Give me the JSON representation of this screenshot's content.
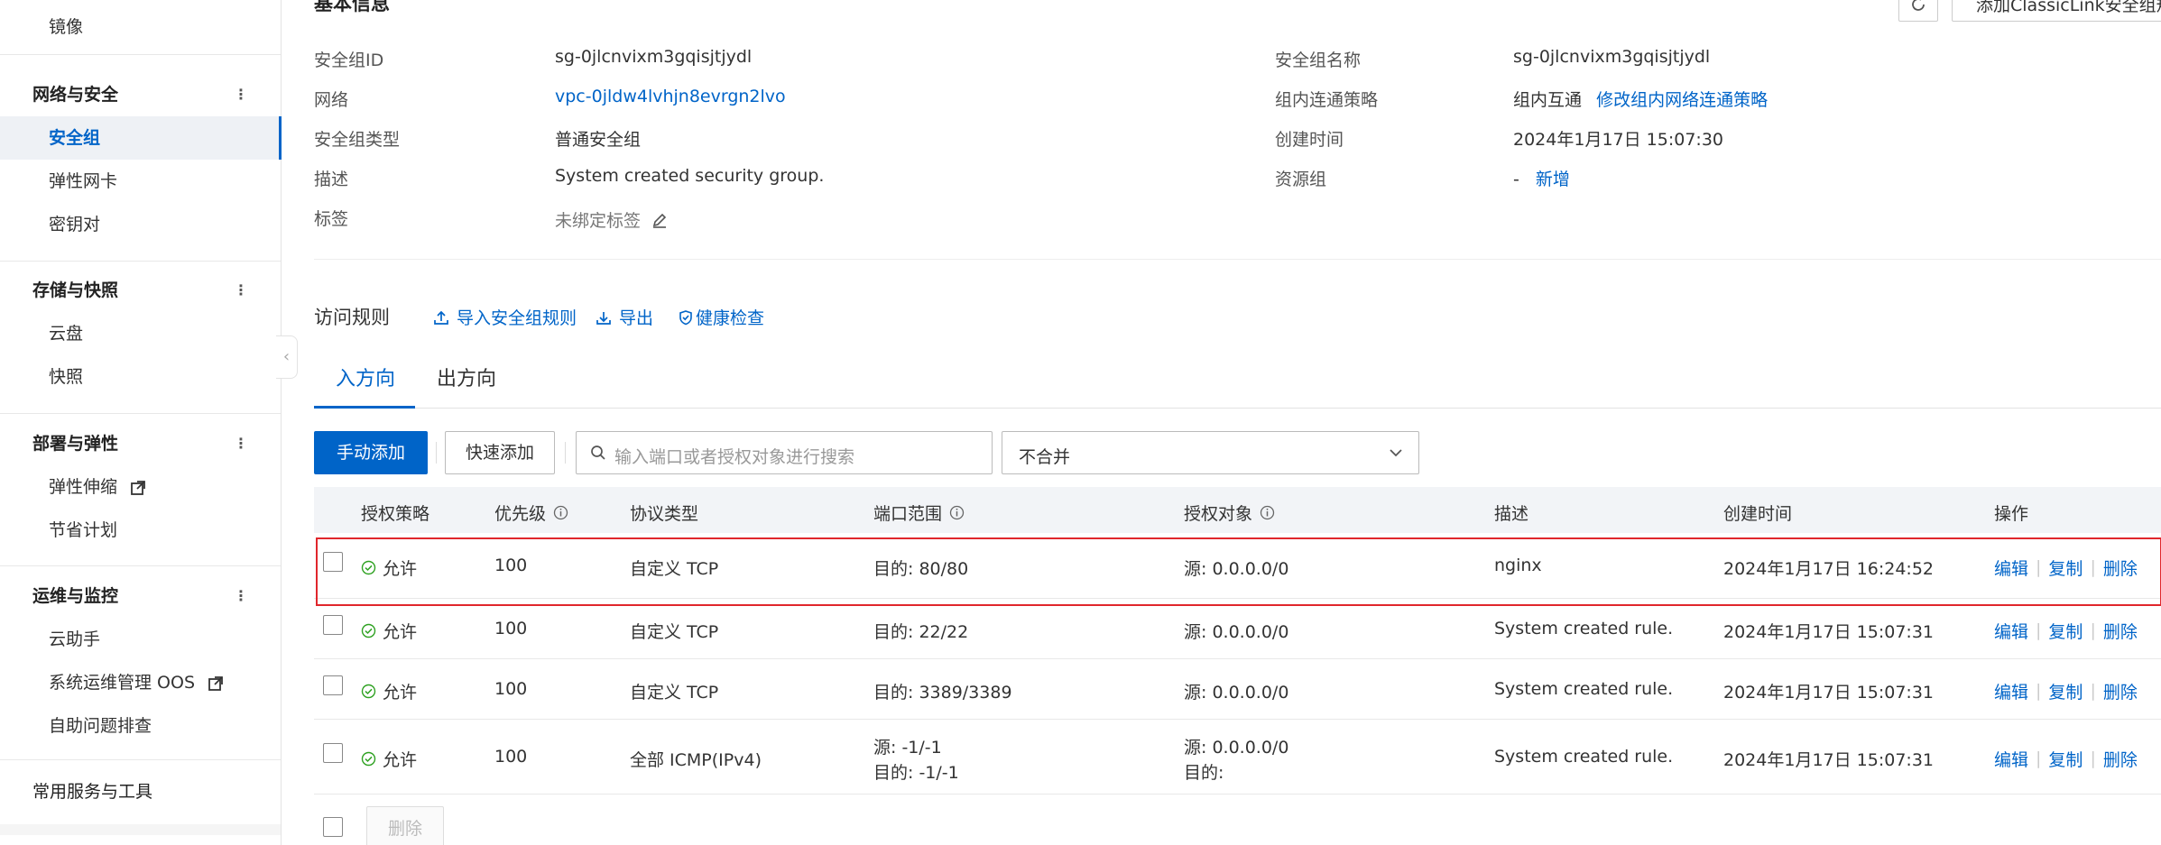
{
  "sidebar": {
    "top_item": "镜像",
    "groups": [
      {
        "label": "网络与安全",
        "items": [
          "安全组",
          "弹性网卡",
          "密钥对"
        ]
      },
      {
        "label": "存储与快照",
        "items": [
          "云盘",
          "快照"
        ]
      },
      {
        "label": "部署与弹性",
        "items": [
          "弹性伸缩",
          "节省计划"
        ]
      },
      {
        "label": "运维与监控",
        "items": [
          "云助手",
          "系统运维管理 OOS",
          "自助问题排查"
        ]
      }
    ],
    "bottom_item": "常用服务与工具",
    "active_item": "安全组"
  },
  "header": {
    "section_title": "基本信息",
    "top_right_button": "添加ClassicLink安全组规则"
  },
  "info": {
    "left": [
      {
        "label": "安全组ID",
        "value": "sg-0jlcnvixm3gqisjtjydl"
      },
      {
        "label": "网络",
        "value": "vpc-0jldw4lvhjn8evrgn2lvo"
      },
      {
        "label": "安全组类型",
        "value": "普通安全组"
      },
      {
        "label": "描述",
        "value": "System created security group."
      },
      {
        "label": "标签",
        "value": "未绑定标签"
      }
    ],
    "right": [
      {
        "label": "安全组名称",
        "value": "sg-0jlcnvixm3gqisjtjydl"
      },
      {
        "label": "组内连通策略",
        "value": "组内互通",
        "link": "修改组内网络连通策略"
      },
      {
        "label": "创建时间",
        "value": "2024年1月17日 15:07:30"
      },
      {
        "label": "资源组",
        "value": "-",
        "link": "新增"
      }
    ]
  },
  "rules": {
    "title": "访问规则",
    "actions": [
      "导入安全组规则",
      "导出",
      "健康检查"
    ],
    "tabs": [
      "入方向",
      "出方向"
    ],
    "active_tab": "入方向",
    "buttons": {
      "manual_add": "手动添加",
      "quick_add": "快速添加"
    },
    "search_placeholder": "输入端口或者授权对象进行搜索",
    "merge_select": "不合并",
    "columns": [
      "授权策略",
      "优先级",
      "协议类型",
      "端口范围",
      "授权对象",
      "描述",
      "创建时间",
      "操作"
    ],
    "rows": [
      {
        "policy": "允许",
        "priority": "100",
        "protocol": "自定义 TCP",
        "port": "目的: 80/80",
        "port2": "",
        "object": "源: 0.0.0.0/0",
        "object2": "",
        "desc": "nginx",
        "created": "2024年1月17日 16:24:52"
      },
      {
        "policy": "允许",
        "priority": "100",
        "protocol": "自定义 TCP",
        "port": "目的: 22/22",
        "port2": "",
        "object": "源: 0.0.0.0/0",
        "object2": "",
        "desc": "System created rule.",
        "created": "2024年1月17日 15:07:31"
      },
      {
        "policy": "允许",
        "priority": "100",
        "protocol": "自定义 TCP",
        "port": "目的: 3389/3389",
        "port2": "",
        "object": "源: 0.0.0.0/0",
        "object2": "",
        "desc": "System created rule.",
        "created": "2024年1月17日 15:07:31"
      },
      {
        "policy": "允许",
        "priority": "100",
        "protocol": "全部 ICMP(IPv4)",
        "port": "源: -1/-1",
        "port2": "目的: -1/-1",
        "object": "源: 0.0.0.0/0",
        "object2": "目的:",
        "desc": "System created rule.",
        "created": "2024年1月17日 15:07:31"
      }
    ],
    "row_ops": [
      "编辑",
      "复制",
      "删除"
    ],
    "footer_delete": "删除"
  },
  "colors": {
    "accent": "#0064c8",
    "allow": "#2ea121",
    "highlight": "#e0262c"
  }
}
